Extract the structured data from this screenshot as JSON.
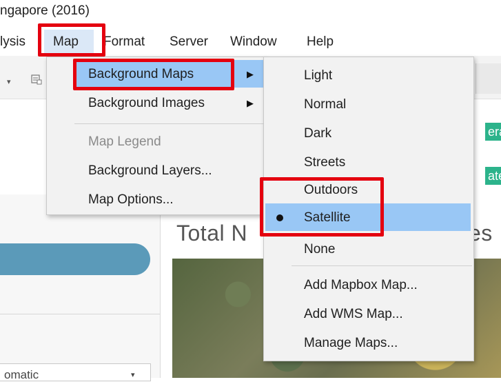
{
  "window": {
    "title": "ngapore (2016)"
  },
  "menubar": {
    "items": [
      {
        "label": "lysis"
      },
      {
        "label": "Map"
      },
      {
        "label": "Format"
      },
      {
        "label": "Server"
      },
      {
        "label": "Window"
      },
      {
        "label": "Help"
      }
    ]
  },
  "map_menu": {
    "items": [
      {
        "label": "Background Maps"
      },
      {
        "label": "Background Images"
      },
      {
        "label": "Map Legend"
      },
      {
        "label": "Background Layers..."
      },
      {
        "label": "Map Options..."
      }
    ]
  },
  "background_maps_menu": {
    "items": [
      {
        "label": "Light"
      },
      {
        "label": "Normal"
      },
      {
        "label": "Dark"
      },
      {
        "label": "Streets"
      },
      {
        "label": "Outdoors"
      },
      {
        "label": "Satellite",
        "selected": true
      },
      {
        "label": "None"
      },
      {
        "label": "Add Mapbox Map..."
      },
      {
        "label": "Add WMS Map..."
      },
      {
        "label": "Manage Maps..."
      }
    ]
  },
  "badges": [
    {
      "label": "erat"
    },
    {
      "label": "atec"
    }
  ],
  "view": {
    "title": "Total N",
    "title_tail": "es"
  },
  "left_panel": {
    "combo_value": "omatic"
  },
  "colors": {
    "accent_highlight": "#99c7f5",
    "annotation_red": "#e4000f",
    "badge_green": "#2cb38b",
    "pill_blue": "#5b9ab9"
  },
  "icons": {
    "submenu": "triangle-right-icon",
    "selected": "bullet-icon",
    "dropdown": "chevron-down-icon"
  }
}
